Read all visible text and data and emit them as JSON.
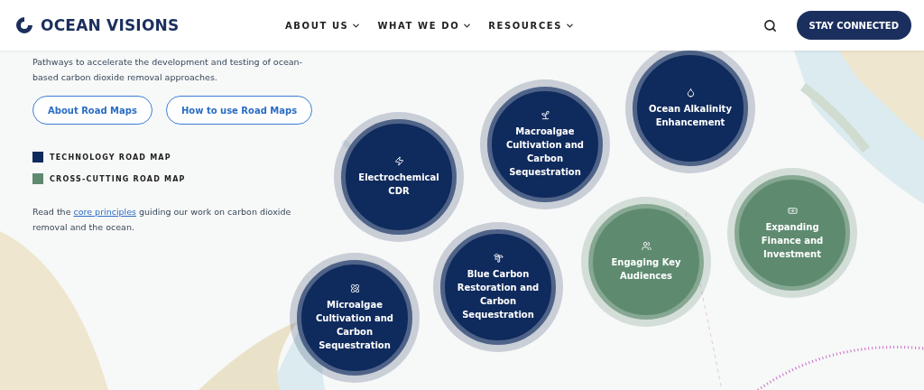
{
  "header": {
    "logo": "OCEAN VISIONS",
    "nav": [
      {
        "label": "ABOUT US"
      },
      {
        "label": "WHAT WE DO"
      },
      {
        "label": "RESOURCES"
      }
    ],
    "cta": "STAY CONNECTED"
  },
  "intro": "Pathways to accelerate the development and testing of ocean-based carbon dioxide removal approaches.",
  "buttons": [
    "About Road Maps",
    "How to use Road Maps"
  ],
  "legend": [
    {
      "label": "TECHNOLOGY ROAD MAP",
      "color": "#0f2a5c"
    },
    {
      "label": "CROSS-CUTTING ROAD MAP",
      "color": "#5e8a70"
    }
  ],
  "footnote": {
    "before": "Read the ",
    "link": "core principles",
    "after": " guiding our work on carbon dioxide removal and the ocean."
  },
  "road_maps": [
    {
      "label": "Electrochemical CDR",
      "kind": "technology"
    },
    {
      "label": "Macroalgae Cultivation and Carbon Sequestration",
      "kind": "technology"
    },
    {
      "label": "Ocean Alkalinity Enhancement",
      "kind": "technology"
    },
    {
      "label": "Microalgae Cultivation and Carbon Sequestration",
      "kind": "technology"
    },
    {
      "label": "Blue Carbon Restoration and Carbon Sequestration",
      "kind": "technology"
    },
    {
      "label": "Engaging Key Audiences",
      "kind": "cross-cutting"
    },
    {
      "label": "Expanding Finance and Investment",
      "kind": "cross-cutting"
    }
  ]
}
